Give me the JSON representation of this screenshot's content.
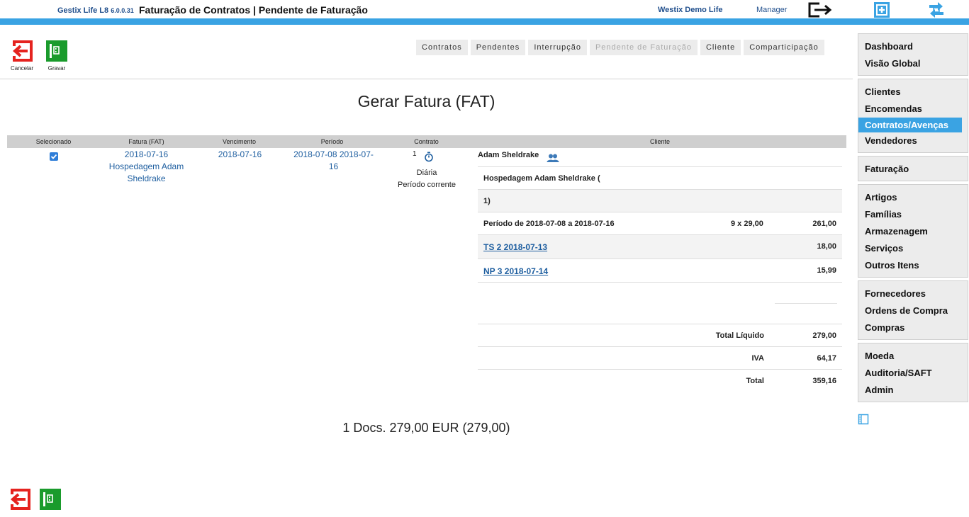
{
  "header": {
    "brand": "Gestix Life L8",
    "version": "6.0.0.31",
    "title": "Faturação de Contratos | Pendente de Faturação",
    "company": "Westix Demo Life",
    "user": "Manager"
  },
  "actions": {
    "cancel_label": "Cancelar",
    "save_label": "Gravar"
  },
  "tabs": [
    {
      "label": "Contratos",
      "enabled": true
    },
    {
      "label": "Pendentes",
      "enabled": true
    },
    {
      "label": "Interrupção",
      "enabled": true
    },
    {
      "label": "Pendente de Faturação",
      "enabled": false
    },
    {
      "label": "Cliente",
      "enabled": true
    },
    {
      "label": "Comparticipação",
      "enabled": true
    }
  ],
  "page_title": "Gerar Fatura (FAT)",
  "table": {
    "headers": [
      "Selecionado",
      "Fatura (FAT)",
      "Vencimento",
      "Período",
      "Contrato",
      "Cliente"
    ],
    "row": {
      "selected": true,
      "invoice_date": "2018-07-16",
      "invoice_name": "Hospedagem Adam Sheldrake",
      "due_date": "2018-07-16",
      "period": "2018-07-08 2018-07-16",
      "contract_num": "1",
      "contract_freq": "Diária",
      "contract_period": "Período corrente",
      "client_name": "Adam Sheldrake"
    }
  },
  "detail": {
    "desc_line1": "Hospedagem Adam Sheldrake (",
    "desc_line2": "1)",
    "period_label": "Período de 2018-07-08 a 2018-07-16",
    "period_qty": "9 x 29,00",
    "period_value": "261,00",
    "items": [
      {
        "label": "TS 2 2018-07-13",
        "value": "18,00"
      },
      {
        "label": "NP 3 2018-07-14",
        "value": "15,99"
      }
    ],
    "totals": [
      {
        "label": "Total Líquido",
        "value": "279,00"
      },
      {
        "label": "IVA",
        "value": "64,17"
      },
      {
        "label": "Total",
        "value": "359,16"
      }
    ]
  },
  "summary": "1 Docs. 279,00 EUR (279,00)",
  "sidebar": {
    "groups": [
      [
        "Dashboard",
        "Visão Global"
      ],
      [
        "Clientes",
        "Encomendas",
        "Contratos/Avenças",
        "Vendedores"
      ],
      [
        "Faturação"
      ],
      [
        "Artigos",
        "Famílias",
        "Armazenagem",
        "Serviços",
        "Outros Itens"
      ],
      [
        "Fornecedores",
        "Ordens de Compra",
        "Compras"
      ],
      [
        "Moeda",
        "Auditoria/SAFT",
        "Admin"
      ]
    ],
    "active": "Contratos/Avenças"
  },
  "colors": {
    "accent": "#3aa3e3",
    "cancel": "#e5231f",
    "save": "#1a9b2c",
    "link": "#1f5fa0"
  },
  "icons": [
    "logout-icon",
    "add-icon",
    "refresh-icon",
    "cancel-icon",
    "save-icon",
    "timer-icon",
    "users-icon",
    "notebook-icon"
  ]
}
